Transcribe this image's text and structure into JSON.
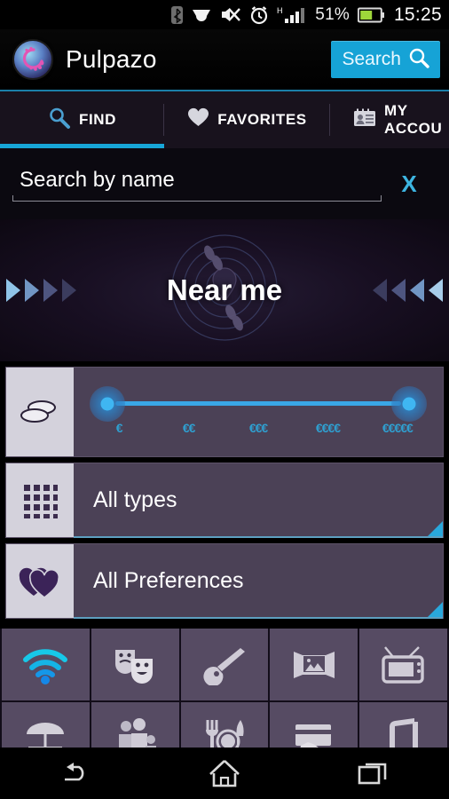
{
  "statusbar": {
    "icons": [
      "bluetooth-icon",
      "headset-icon",
      "mute-icon",
      "alarm-icon"
    ],
    "network_type": "H",
    "battery_percent": "51%",
    "time": "15:25"
  },
  "appbar": {
    "logo_name": "pulpazo-logo",
    "title": "Pulpazo",
    "search_label": "Search",
    "accent": "#16a3d6"
  },
  "tabs": [
    {
      "label": "FIND",
      "icon": "magnifier-icon",
      "active": true
    },
    {
      "label": "FAVORITES",
      "icon": "heart-icon",
      "active": false
    },
    {
      "label": "MY ACCOU",
      "icon": "id-card-icon",
      "active": false
    }
  ],
  "search": {
    "placeholder": "Search by name",
    "value": "",
    "clear_label": "X",
    "clear_color": "#3db4e0"
  },
  "hero": {
    "title": "Near me",
    "left_arrows": 4,
    "right_arrows": 4,
    "background_icon": "radar-location-footprints"
  },
  "price_filter": {
    "icon": "coins-icon",
    "ticks": [
      "€",
      "€€",
      "€€€",
      "€€€€",
      "€€€€€"
    ],
    "low_value": "€",
    "high_value": "€€€€€",
    "tick_color": "#2f9fd0"
  },
  "filters": [
    {
      "label": "All types",
      "icon": "grid-icon"
    },
    {
      "label": "All Preferences",
      "icon": "hearts-icon"
    }
  ],
  "amenities": [
    {
      "name": "wifi-icon",
      "active": true
    },
    {
      "name": "theater-masks-icon",
      "active": false
    },
    {
      "name": "guitar-icon",
      "active": false
    },
    {
      "name": "art-picture-icon",
      "active": false
    },
    {
      "name": "television-icon",
      "active": false
    },
    {
      "name": "terrace-umbrella-icon",
      "active": false
    },
    {
      "name": "family-icon",
      "active": false
    },
    {
      "name": "restaurant-icon",
      "active": false
    },
    {
      "name": "card-payment-icon",
      "active": false
    },
    {
      "name": "music-speaker-icon",
      "active": false
    }
  ],
  "navbar": [
    {
      "name": "back-icon"
    },
    {
      "name": "home-icon"
    },
    {
      "name": "recents-icon"
    }
  ]
}
